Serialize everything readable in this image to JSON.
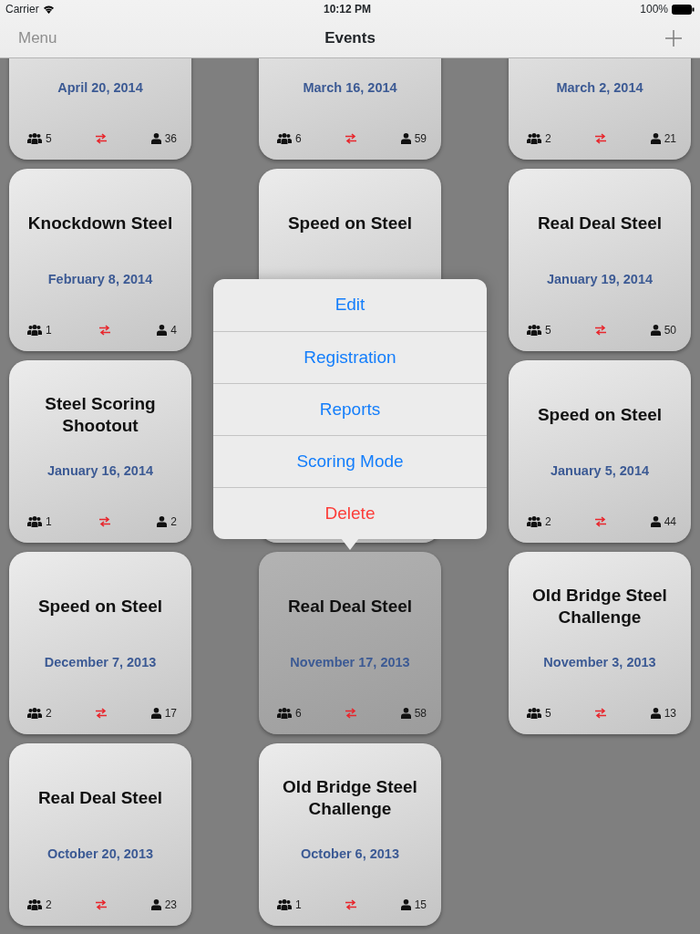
{
  "status_bar": {
    "carrier": "Carrier",
    "time": "10:12 PM",
    "battery": "100%"
  },
  "nav_bar": {
    "left_button": "Menu",
    "title": "Events"
  },
  "events": [
    {
      "date": "April 20, 2014",
      "teams": "5",
      "shooters": "36",
      "selected": false
    },
    {
      "date": "March 16, 2014",
      "teams": "6",
      "shooters": "59",
      "selected": false
    },
    {
      "date": "March 2, 2014",
      "teams": "2",
      "shooters": "21",
      "selected": false
    },
    {
      "title": "Knockdown Steel",
      "date": "February 8, 2014",
      "teams": "1",
      "shooters": "4",
      "selected": false
    },
    {
      "title": "Speed on Steel",
      "selected": false
    },
    {
      "title": "Real Deal Steel",
      "date": "January 19, 2014",
      "teams": "5",
      "shooters": "50",
      "selected": false
    },
    {
      "title": "Steel Scoring Shootout",
      "date": "January 16, 2014",
      "teams": "1",
      "shooters": "2",
      "selected": false
    },
    {
      "selected": false
    },
    {
      "title": "Speed on Steel",
      "date": "January 5, 2014",
      "teams": "2",
      "shooters": "44",
      "selected": false
    },
    {
      "title": "Speed on Steel",
      "date": "December 7, 2013",
      "teams": "2",
      "shooters": "17",
      "selected": false
    },
    {
      "title": "Real Deal Steel",
      "date": "November 17, 2013",
      "teams": "6",
      "shooters": "58",
      "selected": true
    },
    {
      "title": "Old Bridge Steel Challenge",
      "date": "November 3, 2013",
      "teams": "5",
      "shooters": "13",
      "selected": false
    },
    {
      "title": "Real Deal Steel",
      "date": "October 20, 2013",
      "teams": "2",
      "shooters": "23",
      "selected": false
    },
    {
      "title": "Old Bridge Steel Challenge",
      "date": "October 6, 2013",
      "teams": "1",
      "shooters": "15",
      "selected": false
    }
  ],
  "popover": {
    "items": [
      {
        "label": "Edit",
        "kind": "normal"
      },
      {
        "label": "Registration",
        "kind": "normal"
      },
      {
        "label": "Reports",
        "kind": "normal"
      },
      {
        "label": "Scoring Mode",
        "kind": "normal"
      },
      {
        "label": "Delete",
        "kind": "destructive"
      }
    ]
  }
}
